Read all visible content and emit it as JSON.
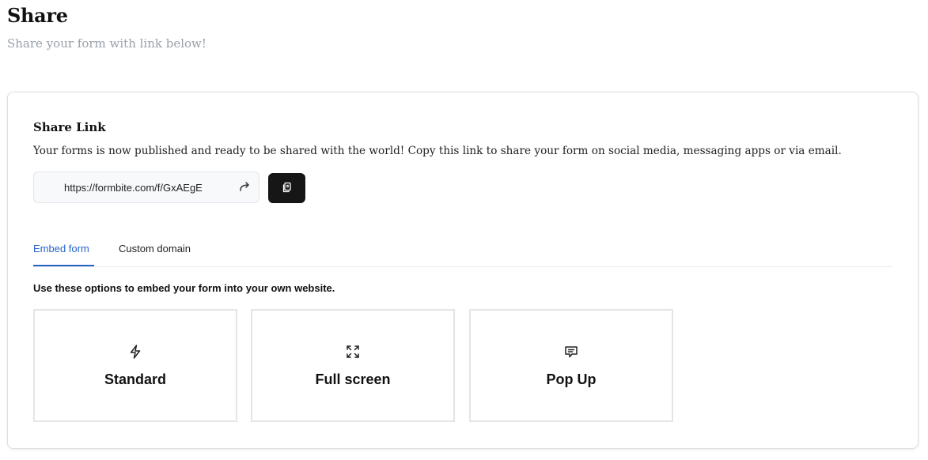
{
  "header": {
    "title": "Share",
    "subtitle": "Share your form with link below!"
  },
  "share_link": {
    "title": "Share Link",
    "description": "Your forms is now published and ready to be shared with the world! Copy this link to share your form on social media, messaging apps or via email.",
    "url": "https://formbite.com/f/GxAEgE",
    "open_icon": "external-link-icon",
    "copy_icon": "copy-icon"
  },
  "tabs": [
    {
      "label": "Embed form",
      "active": true
    },
    {
      "label": "Custom domain",
      "active": false
    }
  ],
  "embed": {
    "description": "Use these options to embed your form into your own website.",
    "options": [
      {
        "label": "Standard",
        "icon": "lightning-icon"
      },
      {
        "label": "Full screen",
        "icon": "expand-icon"
      },
      {
        "label": "Pop Up",
        "icon": "chat-bubble-icon"
      }
    ]
  },
  "colors": {
    "accent": "#2563c9",
    "copy_button_bg": "#161616",
    "subtitle": "#98a0ab"
  }
}
